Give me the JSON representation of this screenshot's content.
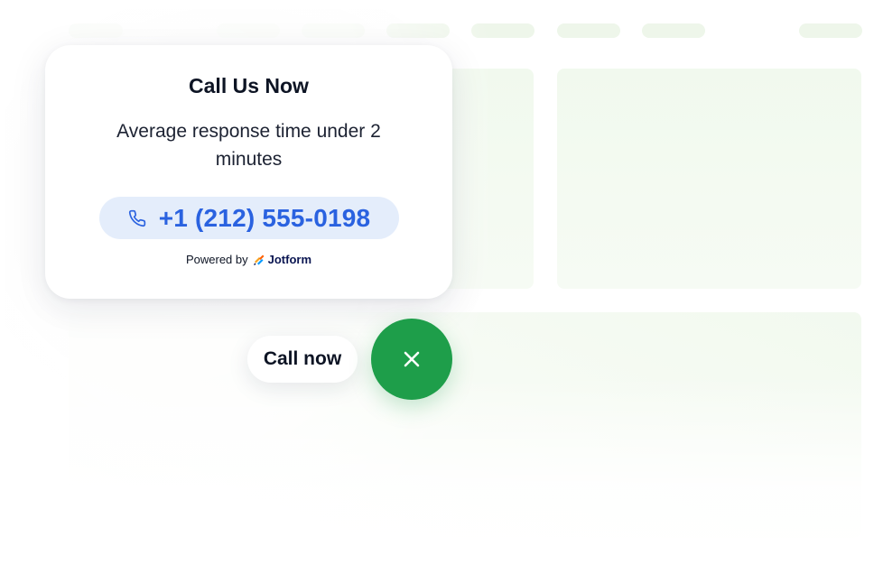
{
  "popup": {
    "title": "Call Us Now",
    "subtitle": "Average response time under 2 minutes",
    "phone_number": "+1 (212) 555-0198",
    "phone_icon": "phone-icon",
    "powered_by_label": "Powered by",
    "brand_name": "Jotform",
    "brand_icon": "jotform-logo"
  },
  "widget": {
    "call_label": "Call now",
    "close_icon": "close-icon"
  },
  "colors": {
    "accent_blue": "#2a62e0",
    "pill_bg": "#e4edfb",
    "fab_green": "#1e9e4a",
    "text_dark": "#0d1424",
    "skeleton_green": "#eef6ea"
  }
}
